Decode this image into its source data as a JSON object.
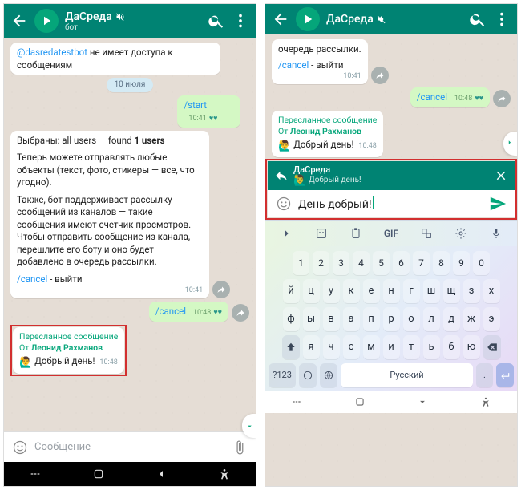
{
  "colors": {
    "accent": "#008373",
    "green": "#05a67a",
    "red": "#d22f2f"
  },
  "left": {
    "header": {
      "title": "ДаСреда",
      "subtitle": "бот",
      "muted_icon": "volume-off-icon"
    },
    "msgs": {
      "m1_prefix": "@dasredatestbot",
      "m1_text": " не имеет доступа к сообщениям",
      "date": "10 июля",
      "m2_text": "/start",
      "m2_time": "10:41",
      "m3_line1a": "Выбраны: all users — found ",
      "m3_line1b": "1 users",
      "m3_p2": "Теперь можете отправлять любые объекты (текст, фото, стикеры — все, что угодно).",
      "m3_p3": "Также, бот поддерживает рассылку сообщений из каналов — такие сообщения имеют счетчик просмотров. Чтобы  отправить сообщение из канала, перешлите его боту и оно будет добавлено в очередь рассылки.",
      "m3_cancel": "/cancel",
      "m3_cancel_suffix": " - выйти",
      "m3_time": "10:41",
      "m4_text": "/cancel",
      "m4_time": "10:48",
      "fwd_head": "Пересланное сообщение",
      "fwd_from_prefix": "От ",
      "fwd_from_name": "Леонид Рахманов",
      "fwd_text": "Добрый день!",
      "fwd_time": "10:48"
    },
    "input": {
      "placeholder": "Сообщение"
    }
  },
  "right": {
    "header": {
      "title": "ДаСреда",
      "muted_icon": "volume-off-icon"
    },
    "msgs": {
      "m0_text": "очередь рассылки.",
      "m0_cancel": "/cancel",
      "m0_cancel_suffix": " - выйти",
      "m0_time": "10:41",
      "m1_text": "/cancel",
      "m1_time": "10:48",
      "fwd_head": "Пересланное сообщение",
      "fwd_from_prefix": "От ",
      "fwd_from_name": "Леонид Рахманов",
      "fwd_text": "Добрый день!",
      "fwd_time": "10:48"
    },
    "reply": {
      "name": "ДаСреда",
      "sub": "Добрый день!"
    },
    "compose": {
      "text": "День добрый!"
    },
    "kb": {
      "nums": [
        "1",
        "2",
        "3",
        "4",
        "5",
        "6",
        "7",
        "8",
        "9",
        "0"
      ],
      "r1": [
        "й",
        "ц",
        "у",
        "к",
        "е",
        "н",
        "г",
        "ш",
        "щ",
        "з",
        "х"
      ],
      "r2": [
        "ф",
        "ы",
        "в",
        "а",
        "п",
        "р",
        "о",
        "л",
        "д",
        "ж",
        "э"
      ],
      "r3": [
        "я",
        "ч",
        "с",
        "м",
        "и",
        "т",
        "ь",
        "б",
        "ю"
      ],
      "sym": "?123",
      "space": "Русский",
      "dot": "."
    }
  }
}
